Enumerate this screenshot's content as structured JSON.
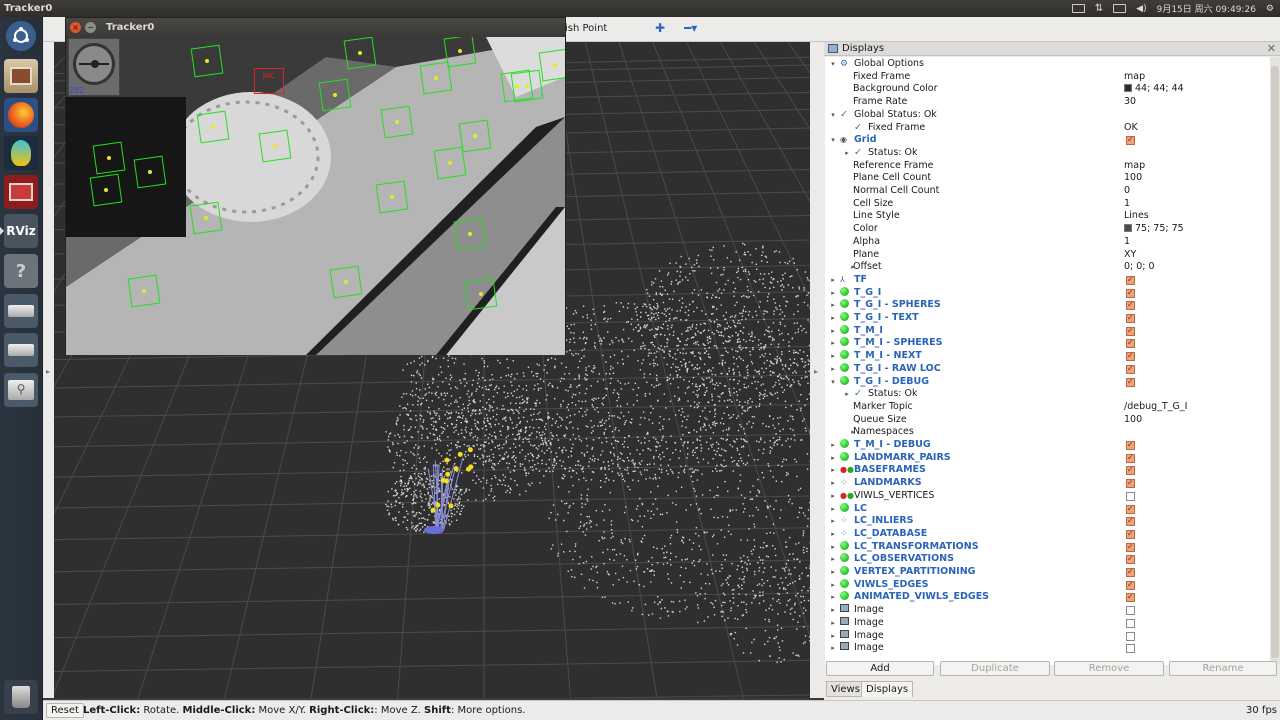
{
  "topbar": {
    "title": "Tracker0",
    "datetime": "9月15日 周六 09:49:26"
  },
  "launcher": {
    "items": [
      "ubuntu-dash",
      "files",
      "firefox",
      "meld",
      "system-monitor",
      "rviz",
      "help",
      "drive-1",
      "drive-2",
      "usb-drive",
      "trash"
    ],
    "rviz_label": "RViz"
  },
  "toolbar": {
    "partial_label": "ish Point"
  },
  "tracker": {
    "title": "Tracker0",
    "counter": "282",
    "loc_tag": "JNC"
  },
  "panel": {
    "title": "Displays",
    "rows": [
      {
        "exp": "▾",
        "icon": "gear",
        "label": "Global Options",
        "value": "",
        "cb": null,
        "bold": false,
        "indent": 0
      },
      {
        "exp": "",
        "icon": "",
        "label": "Fixed Frame",
        "value": "map",
        "cb": null,
        "bold": false,
        "indent": 2
      },
      {
        "exp": "",
        "icon": "",
        "label": "Background Color",
        "value": "44; 44; 44",
        "swatch": "#2c2c2c",
        "cb": null,
        "bold": false,
        "indent": 2
      },
      {
        "exp": "",
        "icon": "",
        "label": "Frame Rate",
        "value": "30",
        "cb": null,
        "bold": false,
        "indent": 2
      },
      {
        "exp": "▾",
        "icon": "check",
        "label": "Global Status: Ok",
        "value": "",
        "cb": null,
        "bold": false,
        "indent": 0
      },
      {
        "exp": "",
        "icon": "check",
        "label": "Fixed Frame",
        "value": "OK",
        "cb": null,
        "bold": false,
        "indent": 1
      },
      {
        "exp": "▾",
        "icon": "eye",
        "label": "Grid",
        "value": "",
        "cb": true,
        "bold": true,
        "indent": 0
      },
      {
        "exp": "▸",
        "icon": "check",
        "label": "Status: Ok",
        "value": "",
        "cb": null,
        "bold": false,
        "indent": 1
      },
      {
        "exp": "",
        "icon": "",
        "label": "Reference Frame",
        "value": "map",
        "cb": null,
        "bold": false,
        "indent": 2
      },
      {
        "exp": "",
        "icon": "",
        "label": "Plane Cell Count",
        "value": "100",
        "cb": null,
        "bold": false,
        "indent": 2
      },
      {
        "exp": "",
        "icon": "",
        "label": "Normal Cell Count",
        "value": "0",
        "cb": null,
        "bold": false,
        "indent": 2
      },
      {
        "exp": "",
        "icon": "",
        "label": "Cell Size",
        "value": "1",
        "cb": null,
        "bold": false,
        "indent": 2
      },
      {
        "exp": "",
        "icon": "",
        "label": "Line Style",
        "value": "Lines",
        "cb": null,
        "bold": false,
        "indent": 2
      },
      {
        "exp": "",
        "icon": "",
        "label": "Color",
        "value": "75; 75; 75",
        "swatch": "#4b4b4b",
        "cb": null,
        "bold": false,
        "indent": 2
      },
      {
        "exp": "",
        "icon": "",
        "label": "Alpha",
        "value": "1",
        "cb": null,
        "bold": false,
        "indent": 2
      },
      {
        "exp": "",
        "icon": "",
        "label": "Plane",
        "value": "XY",
        "cb": null,
        "bold": false,
        "indent": 2
      },
      {
        "exp": "▸",
        "icon": "",
        "label": "Offset",
        "value": "0; 0; 0",
        "cb": null,
        "bold": false,
        "indent": 2
      },
      {
        "exp": "▸",
        "icon": "tf",
        "label": "TF",
        "value": "",
        "cb": true,
        "bold": true,
        "indent": 0
      },
      {
        "exp": "▸",
        "icon": "marker",
        "label": "T_G_I",
        "value": "",
        "cb": true,
        "bold": true,
        "indent": 0
      },
      {
        "exp": "▸",
        "icon": "marker",
        "label": "T_G_I - SPHERES",
        "value": "",
        "cb": true,
        "bold": true,
        "indent": 0
      },
      {
        "exp": "▸",
        "icon": "marker",
        "label": "T_G_I - TEXT",
        "value": "",
        "cb": true,
        "bold": true,
        "indent": 0
      },
      {
        "exp": "▸",
        "icon": "marker",
        "label": "T_M_I",
        "value": "",
        "cb": true,
        "bold": true,
        "indent": 0
      },
      {
        "exp": "▸",
        "icon": "marker",
        "label": "T_M_I - SPHERES",
        "value": "",
        "cb": true,
        "bold": true,
        "indent": 0
      },
      {
        "exp": "▸",
        "icon": "marker",
        "label": "T_M_I - NEXT",
        "value": "",
        "cb": true,
        "bold": true,
        "indent": 0
      },
      {
        "exp": "▸",
        "icon": "marker",
        "label": "T_G_I - RAW LOC",
        "value": "",
        "cb": true,
        "bold": true,
        "indent": 0
      },
      {
        "exp": "▾",
        "icon": "marker",
        "label": "T_G_I - DEBUG",
        "value": "",
        "cb": true,
        "bold": true,
        "indent": 0
      },
      {
        "exp": "▸",
        "icon": "check",
        "label": "Status: Ok",
        "value": "",
        "cb": null,
        "bold": false,
        "indent": 1
      },
      {
        "exp": "",
        "icon": "",
        "label": "Marker Topic",
        "value": "/debug_T_G_I",
        "cb": null,
        "bold": false,
        "indent": 2
      },
      {
        "exp": "",
        "icon": "",
        "label": "Queue Size",
        "value": "100",
        "cb": null,
        "bold": false,
        "indent": 2
      },
      {
        "exp": "▸",
        "icon": "",
        "label": "Namespaces",
        "value": "",
        "cb": null,
        "bold": false,
        "indent": 2
      },
      {
        "exp": "▸",
        "icon": "marker",
        "label": "T_M_I - DEBUG",
        "value": "",
        "cb": true,
        "bold": true,
        "indent": 0
      },
      {
        "exp": "▸",
        "icon": "marker",
        "label": "LANDMARK_PAIRS",
        "value": "",
        "cb": true,
        "bold": true,
        "indent": 0
      },
      {
        "exp": "▸",
        "icon": "markerarray",
        "label": "BASEFRAMES",
        "value": "",
        "cb": true,
        "bold": true,
        "indent": 0
      },
      {
        "exp": "▸",
        "icon": "pointcloud",
        "label": "LANDMARKS",
        "value": "",
        "cb": true,
        "bold": true,
        "indent": 0
      },
      {
        "exp": "▸",
        "icon": "markerarray",
        "label": "VIWLS_VERTICES",
        "value": "",
        "cb": false,
        "bold": false,
        "indent": 0
      },
      {
        "exp": "▸",
        "icon": "marker",
        "label": "LC",
        "value": "",
        "cb": true,
        "bold": true,
        "indent": 0
      },
      {
        "exp": "▸",
        "icon": "pointcloud",
        "label": "LC_INLIERS",
        "value": "",
        "cb": true,
        "bold": true,
        "indent": 0
      },
      {
        "exp": "▸",
        "icon": "pointcloud",
        "label": "LC_DATABASE",
        "value": "",
        "cb": true,
        "bold": true,
        "indent": 0
      },
      {
        "exp": "▸",
        "icon": "marker",
        "label": "LC_TRANSFORMATIONS",
        "value": "",
        "cb": true,
        "bold": true,
        "indent": 0
      },
      {
        "exp": "▸",
        "icon": "marker",
        "label": "LC_OBSERVATIONS",
        "value": "",
        "cb": true,
        "bold": true,
        "indent": 0
      },
      {
        "exp": "▸",
        "icon": "marker",
        "label": "VERTEX_PARTITIONING",
        "value": "",
        "cb": true,
        "bold": true,
        "indent": 0
      },
      {
        "exp": "▸",
        "icon": "marker",
        "label": "VIWLS_EDGES",
        "value": "",
        "cb": true,
        "bold": true,
        "indent": 0
      },
      {
        "exp": "▸",
        "icon": "marker",
        "label": "ANIMATED_VIWLS_EDGES",
        "value": "",
        "cb": true,
        "bold": true,
        "indent": 0
      },
      {
        "exp": "▸",
        "icon": "image",
        "label": "Image",
        "value": "",
        "cb": false,
        "bold": false,
        "indent": 0
      },
      {
        "exp": "▸",
        "icon": "image",
        "label": "Image",
        "value": "",
        "cb": false,
        "bold": false,
        "indent": 0
      },
      {
        "exp": "▸",
        "icon": "image",
        "label": "Image",
        "value": "",
        "cb": false,
        "bold": false,
        "indent": 0
      },
      {
        "exp": "▸",
        "icon": "image",
        "label": "Image",
        "value": "",
        "cb": false,
        "bold": false,
        "indent": 0
      }
    ],
    "buttons": {
      "add": "Add",
      "duplicate": "Duplicate",
      "remove": "Remove",
      "rename": "Rename"
    },
    "tabs": {
      "views": "Views",
      "displays": "Displays"
    }
  },
  "status": {
    "reset": "Reset",
    "hint_parts": [
      {
        "b": "Left-Click:",
        "t": " Rotate. "
      },
      {
        "b": "Middle-Click:",
        "t": " Move X/Y. "
      },
      {
        "b": "Right-Click:",
        "t": ": Move Z. "
      },
      {
        "b": "Shift",
        "t": ": More options."
      }
    ],
    "fps": "30 fps"
  },
  "colors": {
    "grid_line": "#4b4b4b",
    "background": "#2c2c2c",
    "marker_green": "#16b816",
    "label_blue": "#2a64b8",
    "checkbox_on": "#f0a37a"
  }
}
